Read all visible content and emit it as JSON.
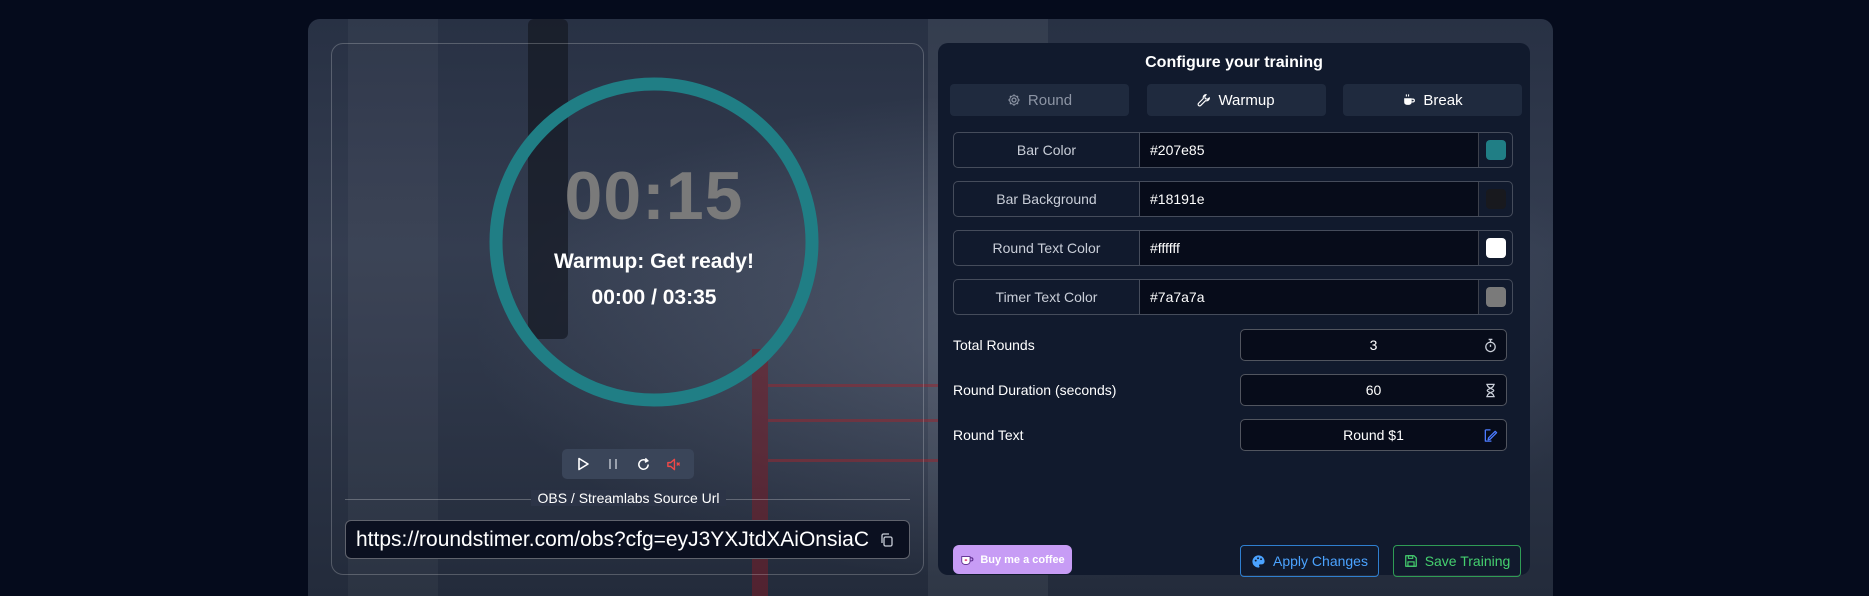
{
  "timer": {
    "display": "00:15",
    "status": "Warmup: Get ready!",
    "progress_text": "00:00 / 03:35",
    "ring_color": "#207e85",
    "ring_progress": 1.0
  },
  "controls": {
    "play_icon": "play-icon",
    "pause_icon": "pause-icon",
    "reset_icon": "reset-icon",
    "mute_icon": "mute-icon"
  },
  "source": {
    "title": "OBS / Streamlabs Source Url",
    "url": "https://roundstimer.com/obs?cfg=eyJ3YXJtdXAiOnsiaC"
  },
  "config": {
    "title": "Configure your training",
    "tabs": [
      {
        "label": "Round",
        "icon": "gear-icon",
        "active": true
      },
      {
        "label": "Warmup",
        "icon": "wrench-icon",
        "active": false
      },
      {
        "label": "Break",
        "icon": "coffee-cup-icon",
        "active": false
      }
    ],
    "colors": [
      {
        "label": "Bar Color",
        "value": "#207e85",
        "swatch": "#207e85"
      },
      {
        "label": "Bar Background",
        "value": "#18191e",
        "swatch": "#18191e"
      },
      {
        "label": "Round Text Color",
        "value": "#ffffff",
        "swatch": "#ffffff"
      },
      {
        "label": "Timer Text Color",
        "value": "#7a7a7a",
        "swatch": "#7a7a7a"
      }
    ],
    "fields": [
      {
        "label": "Total Rounds",
        "value": "3",
        "icon": "stopwatch-icon"
      },
      {
        "label": "Round Duration (seconds)",
        "value": "60",
        "icon": "hourglass-icon"
      },
      {
        "label": "Round Text",
        "value": "Round $1",
        "icon": "edit-icon"
      }
    ],
    "coffee_label": "Buy me a coffee",
    "apply_label": "Apply Changes",
    "save_label": "Save Training"
  }
}
